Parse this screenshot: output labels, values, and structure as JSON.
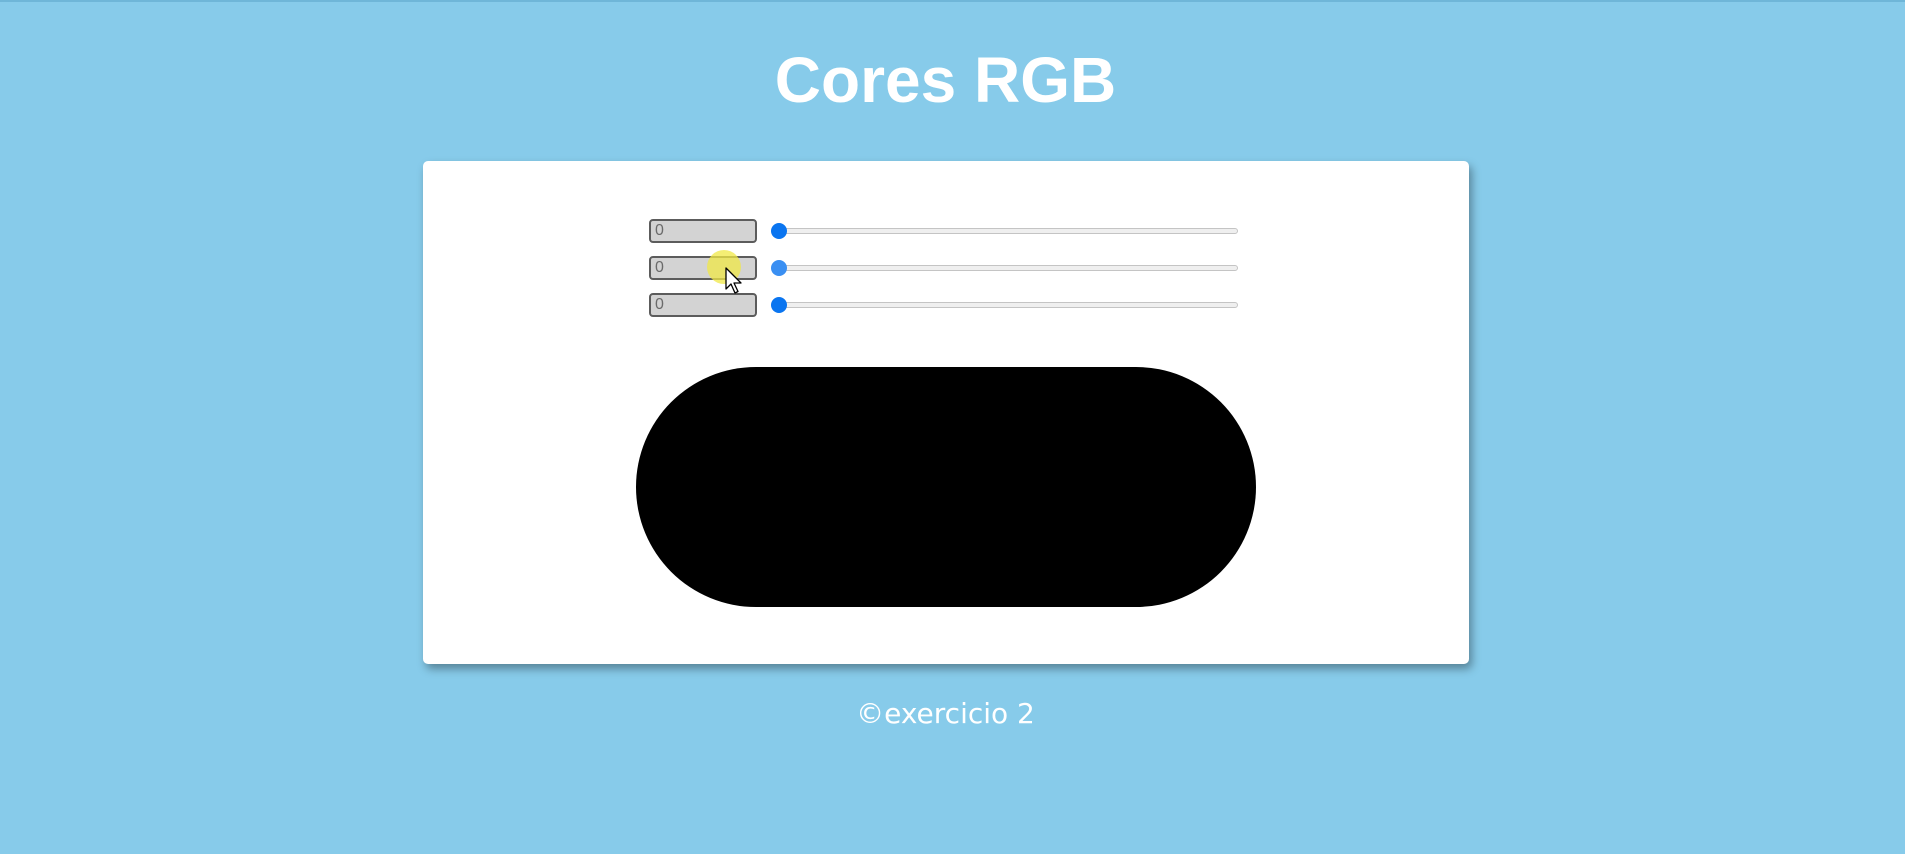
{
  "page": {
    "title": "Cores RGB",
    "footer": "©exercicio 2"
  },
  "controls": [
    {
      "channel": "red",
      "value": "0",
      "slider_value": 0,
      "slider_min": 0,
      "slider_max": 255
    },
    {
      "channel": "green",
      "value": "0",
      "slider_value": 0,
      "slider_min": 0,
      "slider_max": 255
    },
    {
      "channel": "blue",
      "value": "0",
      "slider_value": 0,
      "slider_min": 0,
      "slider_max": 255
    }
  ],
  "preview": {
    "color": "#000000"
  },
  "colors": {
    "background": "#87cbea",
    "card": "#ffffff",
    "slider_accent": "#0a75f0",
    "title_text": "#ffffff"
  },
  "icons": {
    "cursor": "mouse-pointer-icon"
  }
}
